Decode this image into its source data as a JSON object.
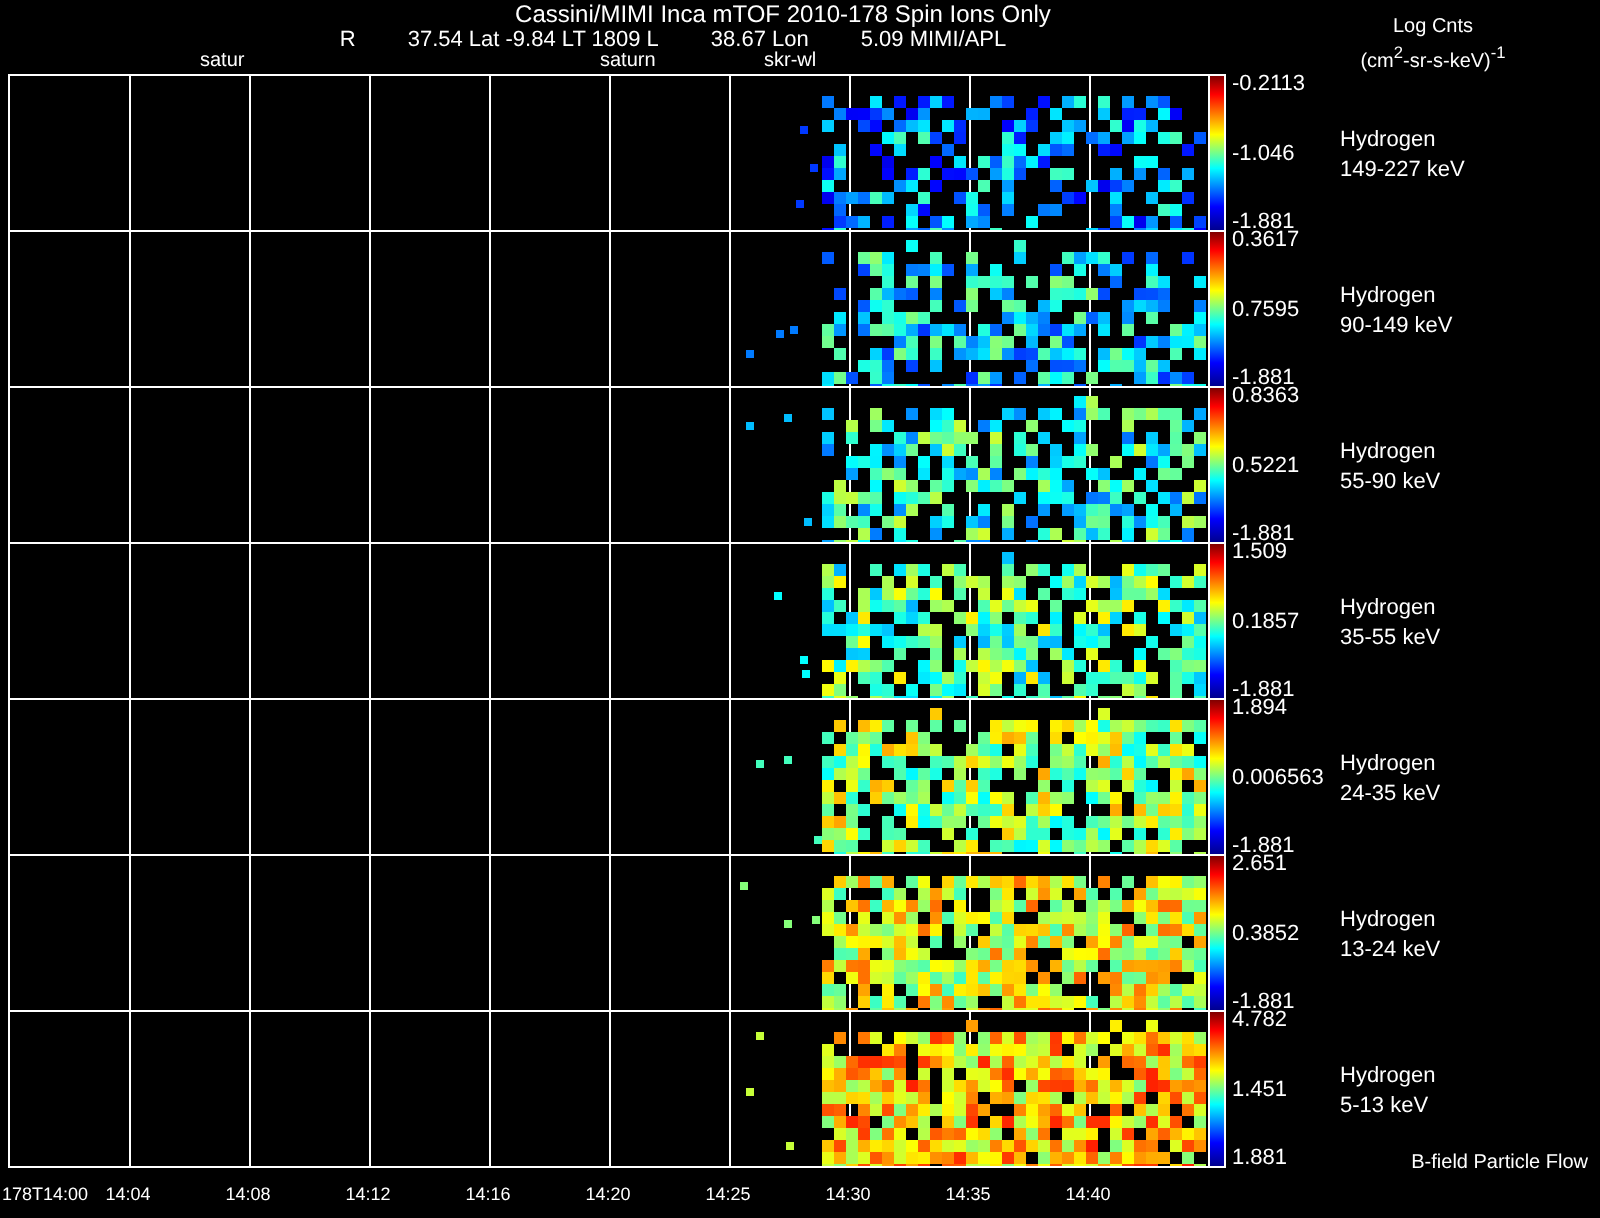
{
  "header": {
    "title": "Cassini/MIMI Inca mTOF  2010-178   Spin   Ions Only",
    "info": [
      "R",
      "37.54 Lat -9.84 LT 1809 L",
      "38.67 Lon",
      "5.09  MIMI/APL"
    ],
    "markers": [
      "satur",
      "saturn",
      "skr-wl"
    ]
  },
  "colorbar_title": {
    "line1": "Log Cnts",
    "line2": "(cm$^{2}$-sr-s-keV)$^{-1}$"
  },
  "panels": [
    {
      "species": "Hydrogen",
      "energy": "149-227 keV",
      "max": "-0.2113",
      "mid": "-1.046",
      "min": "-1.881"
    },
    {
      "species": "Hydrogen",
      "energy": "90-149 keV",
      "max": "0.3617",
      "mid": "0.7595",
      "min": "-1.881"
    },
    {
      "species": "Hydrogen",
      "energy": "55-90 keV",
      "max": "0.8363",
      "mid": "0.5221",
      "min": "-1.881"
    },
    {
      "species": "Hydrogen",
      "energy": "35-55 keV",
      "max": "1.509",
      "mid": "0.1857",
      "min": "-1.881"
    },
    {
      "species": "Hydrogen",
      "energy": "24-35 keV",
      "max": "1.894",
      "mid": "0.006563",
      "min": "-1.881"
    },
    {
      "species": "Hydrogen",
      "energy": "13-24 keV",
      "max": "2.651",
      "mid": "0.3852",
      "min": "-1.881"
    },
    {
      "species": "Hydrogen",
      "energy": "5-13 keV",
      "max": "4.782",
      "mid": "1.451",
      "min": "1.881"
    }
  ],
  "x_ticks": [
    "178T14:00",
    "14:04",
    "14:08",
    "14:12",
    "14:16",
    "14:20",
    "14:25",
    "14:30",
    "14:35",
    "14:40"
  ],
  "footer_note": "B-field Particle Flow"
}
